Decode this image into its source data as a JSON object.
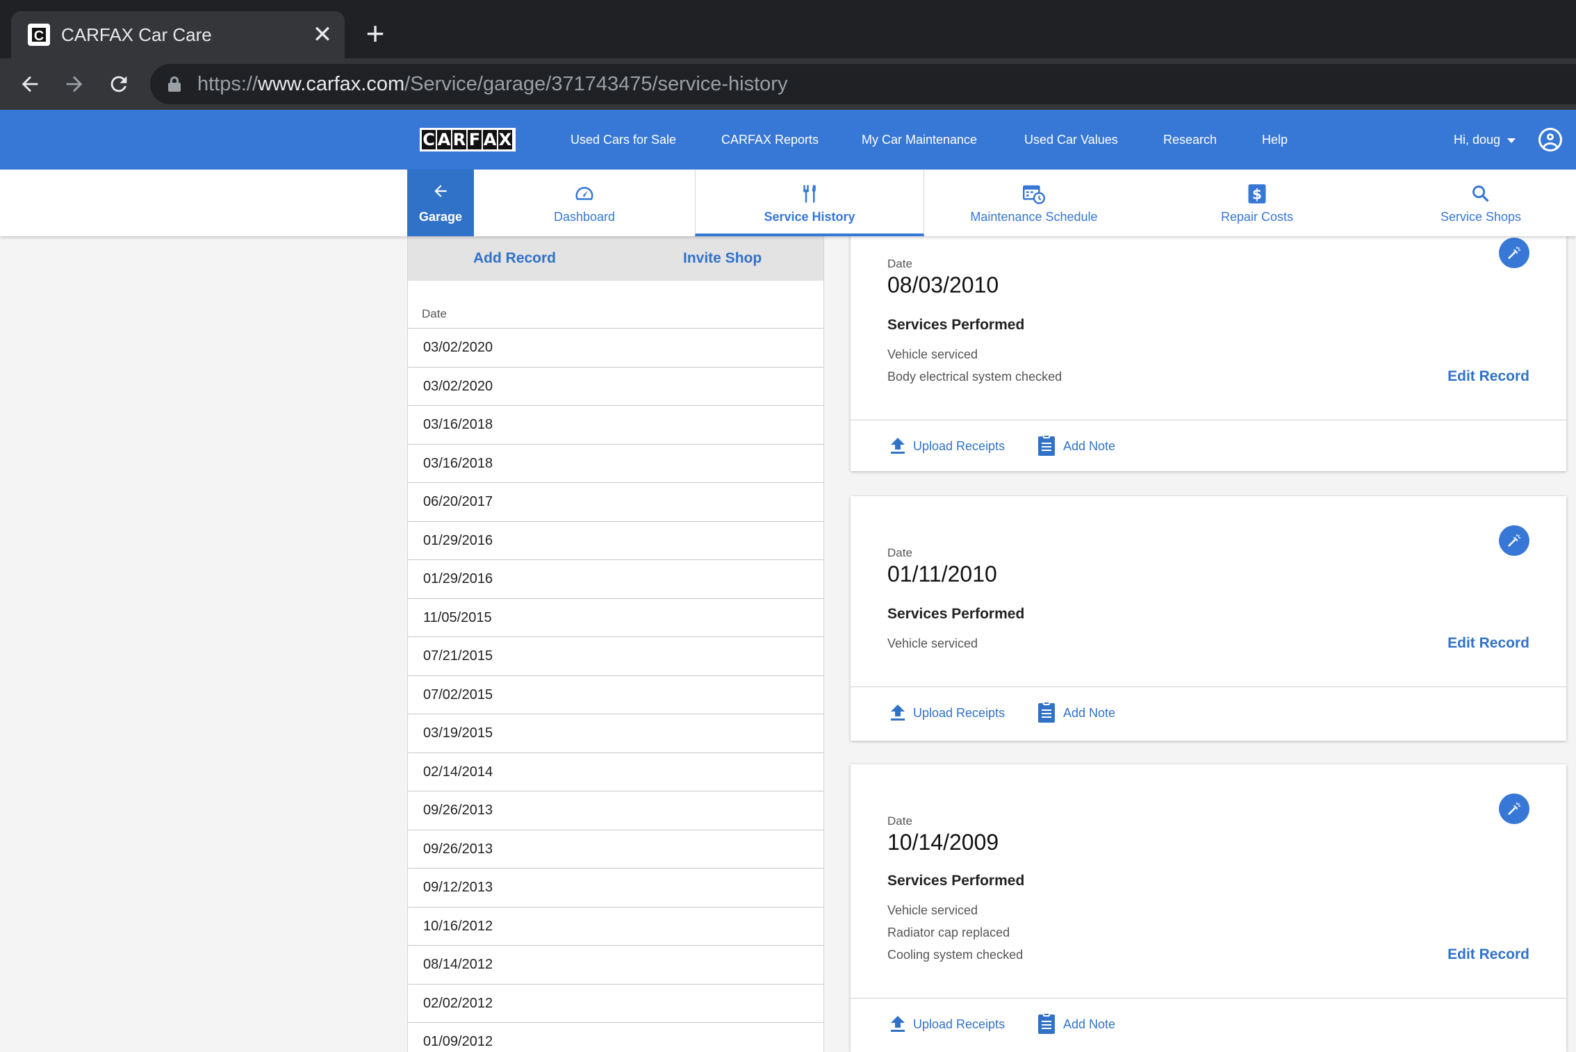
{
  "browser": {
    "tab_title": "CARFAX Car Care",
    "close_glyph": "✕",
    "new_tab_glyph": "+",
    "url_prefix": "https://",
    "url_host": "www.carfax.com",
    "url_path": "/Service/garage/371743475/service-history"
  },
  "topnav": {
    "logo_letters": [
      "C",
      "A",
      "R",
      "F",
      "A",
      "X"
    ],
    "links": [
      "Used Cars for Sale",
      "CARFAX Reports",
      "My Car Maintenance",
      "Used Car Values",
      "Research",
      "Help"
    ],
    "user_greeting": "Hi, doug",
    "brand_color": "#3777d6"
  },
  "subnav": {
    "garage_label": "Garage",
    "tabs": [
      {
        "label": "Dashboard",
        "icon": "speedometer-icon"
      },
      {
        "label": "Service History",
        "icon": "tools-icon",
        "active": true
      },
      {
        "label": "Maintenance Schedule",
        "icon": "calendar-clock-icon"
      },
      {
        "label": "Repair Costs",
        "icon": "dollar-icon"
      },
      {
        "label": "Service Shops",
        "icon": "search-icon"
      }
    ]
  },
  "left_panel": {
    "add_record": "Add Record",
    "invite_shop": "Invite Shop",
    "date_header": "Date",
    "dates": [
      "03/02/2020",
      "03/02/2020",
      "03/16/2018",
      "03/16/2018",
      "06/20/2017",
      "01/29/2016",
      "01/29/2016",
      "11/05/2015",
      "07/21/2015",
      "07/02/2015",
      "03/19/2015",
      "02/14/2014",
      "09/26/2013",
      "09/26/2013",
      "09/12/2013",
      "10/16/2012",
      "08/14/2012",
      "02/02/2012",
      "01/09/2012"
    ]
  },
  "records": [
    {
      "date_label": "Date",
      "date": "08/03/2010",
      "services_title": "Services Performed",
      "services": [
        "Vehicle serviced",
        "Body electrical system checked"
      ],
      "edit_label": "Edit Record",
      "upload_label": "Upload Receipts",
      "note_label": "Add Note"
    },
    {
      "date_label": "Date",
      "date": "01/11/2010",
      "services_title": "Services Performed",
      "services": [
        "Vehicle serviced"
      ],
      "edit_label": "Edit Record",
      "upload_label": "Upload Receipts",
      "note_label": "Add Note"
    },
    {
      "date_label": "Date",
      "date": "10/14/2009",
      "services_title": "Services Performed",
      "services": [
        "Vehicle serviced",
        "Radiator cap replaced",
        "Cooling system checked"
      ],
      "edit_label": "Edit Record",
      "upload_label": "Upload Receipts",
      "note_label": "Add Note"
    }
  ]
}
